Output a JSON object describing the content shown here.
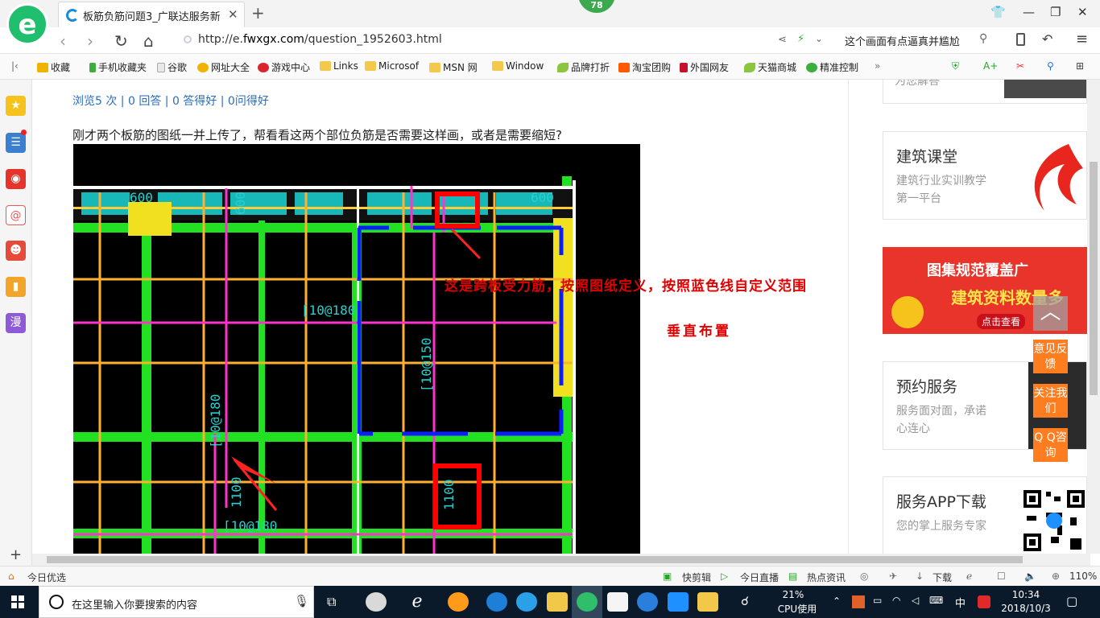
{
  "browser": {
    "tab_title": "板筋负筋问题3_广联达服务新干线",
    "badge_count": "78",
    "url_prefix": "http://e.",
    "url_domain": "fwxgx.com",
    "url_path": "/question_1952603.html",
    "news_ticker": "这个画面有点逼真并尴尬"
  },
  "bookmarks": [
    {
      "label": "收藏",
      "icon": "star-icon",
      "color": "#f0b400"
    },
    {
      "label": "手机收藏夹",
      "icon": "phone-icon",
      "color": "#3cae3c"
    },
    {
      "label": "谷歌",
      "icon": "page-icon",
      "color": "#aaaaaa"
    },
    {
      "label": "网址大全",
      "icon": "globe-icon",
      "color": "#f0b400"
    },
    {
      "label": "游戏中心",
      "icon": "game-icon",
      "color": "#d9262c"
    },
    {
      "label": "Links",
      "icon": "folder-icon",
      "color": "#f4c84a"
    },
    {
      "label": "Microsof",
      "icon": "folder-icon",
      "color": "#f4c84a"
    },
    {
      "label": "MSN 网",
      "icon": "folder-icon",
      "color": "#f4c84a"
    },
    {
      "label": "Window",
      "icon": "folder-icon",
      "color": "#f4c84a"
    },
    {
      "label": "品牌打折",
      "icon": "leaf-icon",
      "color": "#8cc63e"
    },
    {
      "label": "淘宝团购",
      "icon": "taobao-icon",
      "color": "#ff5a00"
    },
    {
      "label": "外国网友",
      "icon": "flag-icon",
      "color": "#c8102e"
    },
    {
      "label": "天猫商城",
      "icon": "leaf-icon",
      "color": "#8cc63e"
    },
    {
      "label": "精准控制",
      "icon": "chat-icon",
      "color": "#3cae3c"
    }
  ],
  "question": {
    "stats": "浏览5 次 | 0 回答 | 0 答得好 | 0问得好",
    "text": "刚才两个板筋的图纸一并上传了，帮看看这两个部位负筋是否需要这样画，或者是需要缩短?"
  },
  "drawing": {
    "labels": [
      "600",
      "600",
      "600",
      "[10@180",
      "[10@150",
      "[10@180",
      "[10@180",
      "1100",
      "1100"
    ],
    "annotation_main": "这是跨板受力筋，按照图纸定义，按照蓝色线自定义范围",
    "annotation_sub": "垂直布置"
  },
  "sidebar_right": {
    "top_partial": "为您解答",
    "cards": [
      {
        "title": "建筑课堂",
        "desc": "建筑行业实训教学第一平台"
      },
      {
        "title": "预约服务",
        "desc": "服务面对面，承诺心连心"
      },
      {
        "title": "服务APP下载",
        "desc": "您的掌上服务专家"
      }
    ],
    "banner_line1": "图集规范覆盖广",
    "banner_line2": "建筑资料数量多",
    "banner_cta": "点击查看",
    "float_buttons": [
      "意见反馈",
      "关注我们",
      "Q Q咨询"
    ]
  },
  "statusbar": {
    "today": "今日优选",
    "items": [
      "快剪辑",
      "今日直播",
      "热点资讯",
      "下载"
    ],
    "zoom": "110%"
  },
  "taskbar": {
    "search_placeholder": "在这里输入你要搜索的内容",
    "cpu_percent": "21%",
    "cpu_label": "CPU使用",
    "ime": "中",
    "time": "10:34",
    "date": "2018/10/3"
  }
}
